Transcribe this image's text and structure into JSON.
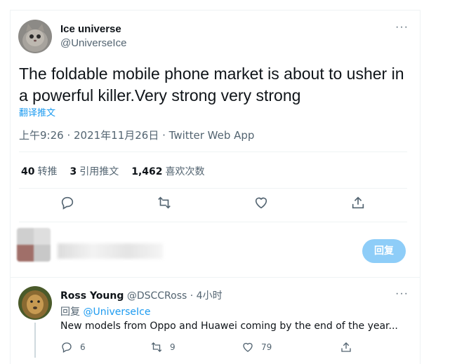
{
  "tweet": {
    "author_name": "Ice universe",
    "author_handle": "@UniverseIce",
    "more_label": "···",
    "text": "The foldable mobile phone market is about to usher in a powerful killer.Very strong very strong",
    "translate_label": "翻译推文",
    "meta": "上午9:26 · 2021年11月26日 · Twitter Web App",
    "stats": {
      "retweets_count": "40",
      "retweets_label": "转推",
      "quotes_count": "3",
      "quotes_label": "引用推文",
      "likes_count": "1,462",
      "likes_label": "喜欢次数"
    },
    "actions": [
      "reply-icon",
      "retweet-icon",
      "like-icon",
      "share-icon"
    ]
  },
  "compose": {
    "reply_button_label": "回复"
  },
  "reply": {
    "author_name": "Ross Young",
    "author_handle": "@DSCCRoss",
    "time": "· 4小时",
    "more_label": "···",
    "replying_prefix": "回复",
    "replying_to": "@UniverseIce",
    "text": "New models from Oppo and Huawei coming by the end of the year...",
    "reply_count": "6",
    "retweet_count": "9",
    "like_count": "79"
  },
  "colors": {
    "accent": "#1d9bf0",
    "reply_button_disabled": "#8ecdf8",
    "secondary_text": "#536471"
  }
}
